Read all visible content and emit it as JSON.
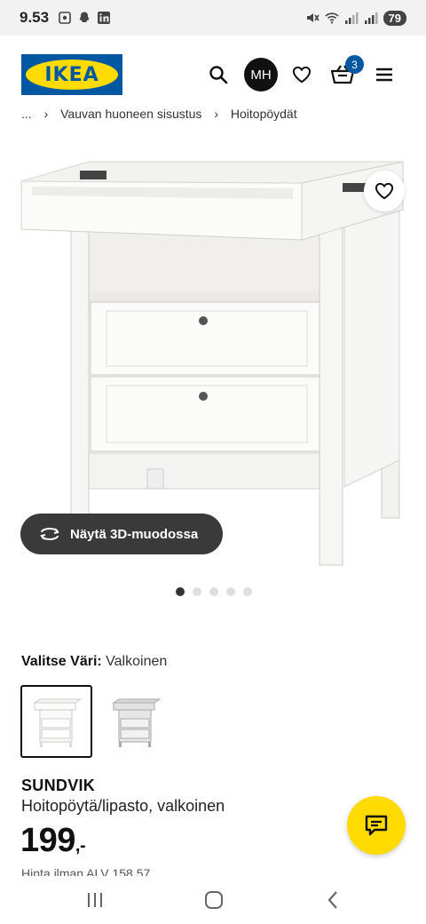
{
  "status_bar": {
    "time": "9.53",
    "battery": "79",
    "icons_left": [
      "screenshot-icon",
      "snapchat-icon",
      "linkedin-icon"
    ],
    "icons_right": [
      "mute-icon",
      "wifi-icon",
      "signal-icon",
      "signal-icon-2"
    ]
  },
  "header": {
    "logo_text": "IKEA",
    "avatar_initials": "MH",
    "cart_count": "3",
    "colors": {
      "brand_blue": "#0058a3",
      "brand_yellow": "#ffdb00"
    }
  },
  "breadcrumb": {
    "items": [
      "...",
      "Vauvan huoneen sisustus",
      "Hoitopöydät"
    ],
    "separator": "›"
  },
  "media": {
    "view_3d_label": "Näytä 3D-muodossa",
    "carousel_count": 5,
    "carousel_active": 1
  },
  "color_select": {
    "label": "Valitse Väri:",
    "value": "Valkoinen",
    "options": [
      "white",
      "grey"
    ]
  },
  "product": {
    "name": "SUNDVIK",
    "description": "Hoitopöytä/lipasto, valkoinen",
    "price": "199",
    "price_suffix": ",-",
    "price_note": "Hinta ilman ALV 158,57"
  },
  "system_nav": {
    "icons": [
      "recent-apps-icon",
      "home-icon",
      "back-icon"
    ]
  }
}
